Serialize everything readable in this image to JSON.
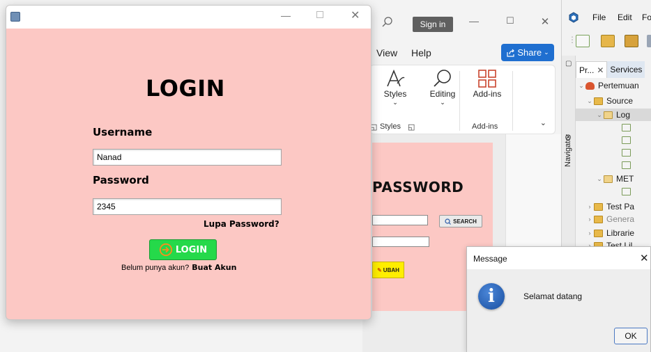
{
  "login_window": {
    "heading": "LOGIN",
    "username_label": "Username",
    "username_value": "Nanad",
    "password_label": "Password",
    "password_value": "2345",
    "forgot_label": "Lupa Password?",
    "login_button": "LOGIN",
    "no_account_text": "Belum punya akun?",
    "create_account_link": "Buat Akun",
    "controls": {
      "minimize": "—",
      "close": "✕"
    },
    "colors": {
      "background": "#fcc8c4",
      "login_button": "#25d94a"
    }
  },
  "word_app": {
    "sign_in": "Sign in",
    "menu": [
      "View",
      "Help"
    ],
    "share_button": "Share",
    "ribbon": {
      "styles_label": "Styles",
      "editing_label": "Editing",
      "addins_label": "Add-ins",
      "group_styles": "Styles",
      "group_addins": "Add-ins"
    },
    "document": {
      "title": "PASSWORD",
      "search_button": "SEARCH",
      "ubah_button": "UBAH"
    }
  },
  "ide": {
    "menu": [
      "File",
      "Edit",
      "Fo"
    ],
    "navigator_label": "Navigator",
    "tabs": [
      "Pr...",
      "Services"
    ],
    "tree": [
      {
        "label": "Pertemuan",
        "depth": 0,
        "icon": "project-icon"
      },
      {
        "label": "Source",
        "depth": 1,
        "icon": "folder-icon"
      },
      {
        "label": "Log",
        "depth": 2,
        "icon": "package-icon",
        "selected": true
      },
      {
        "label": "",
        "depth": 3,
        "icon": "java-file-icon"
      },
      {
        "label": "",
        "depth": 3,
        "icon": "java-file-icon"
      },
      {
        "label": "",
        "depth": 3,
        "icon": "java-file-icon"
      },
      {
        "label": "",
        "depth": 3,
        "icon": "java-file-icon"
      },
      {
        "label": "MET",
        "depth": 2,
        "icon": "package-icon"
      },
      {
        "label": "",
        "depth": 3,
        "icon": "java-file-icon"
      },
      {
        "label": "Test Pa",
        "depth": 1,
        "icon": "folder-icon"
      },
      {
        "label": "Genera",
        "depth": 1,
        "icon": "folder-icon"
      },
      {
        "label": "Librarie",
        "depth": 1,
        "icon": "folder-icon"
      },
      {
        "label": "Test Lil",
        "depth": 1,
        "icon": "folder-icon"
      }
    ]
  },
  "dialog": {
    "title": "Message",
    "message": "Selamat datang",
    "ok_button": "OK",
    "close": "✕"
  }
}
